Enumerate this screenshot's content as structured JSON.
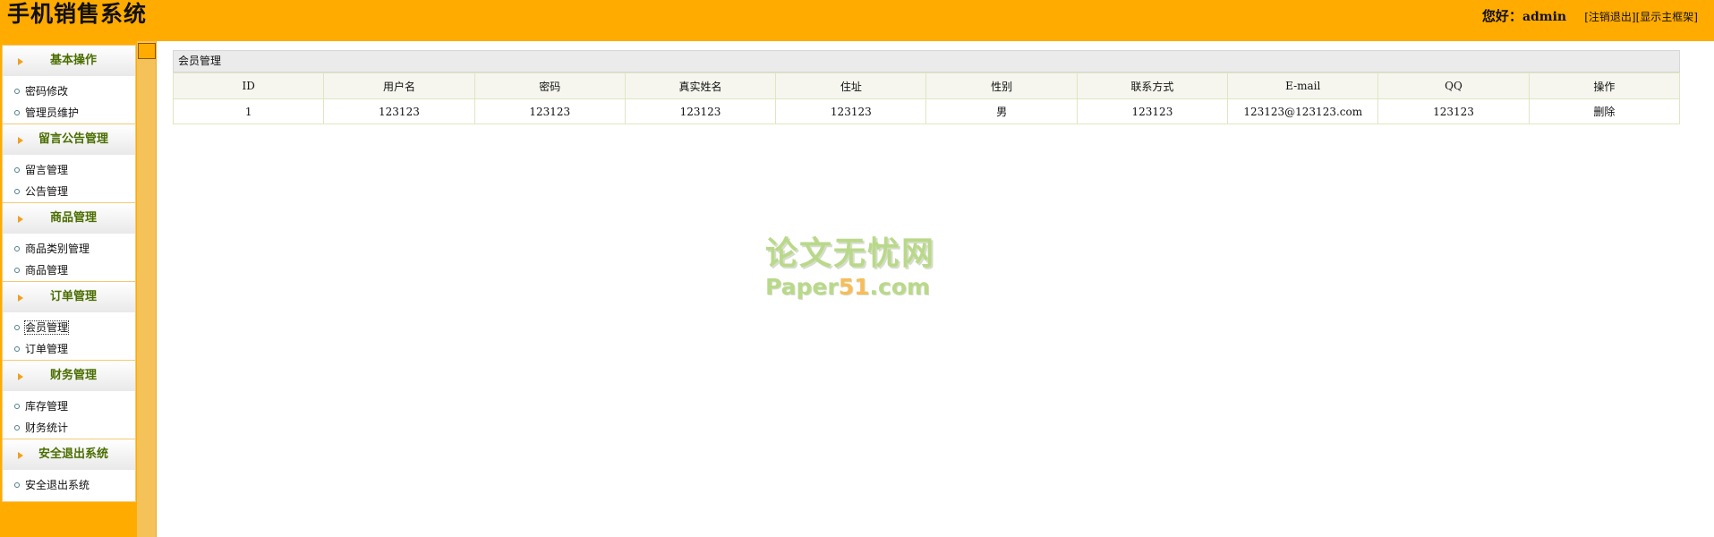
{
  "header": {
    "title": "手机销售系统",
    "greeting_prefix": "您好：",
    "user_name": "admin",
    "logout_link": "[注销退出]",
    "show_frame_link": "[显示主框架]"
  },
  "sidebar": {
    "groups": [
      {
        "title": "基本操作",
        "items": [
          "密码修改",
          "管理员维护"
        ]
      },
      {
        "title": "留言公告管理",
        "items": [
          "留言管理",
          "公告管理"
        ]
      },
      {
        "title": "商品管理",
        "items": [
          "商品类别管理",
          "商品管理"
        ]
      },
      {
        "title": "订单管理",
        "items": [
          "会员管理",
          "订单管理"
        ]
      },
      {
        "title": "财务管理",
        "items": [
          "库存管理",
          "财务统计"
        ]
      },
      {
        "title": "安全退出系统",
        "items": [
          "安全退出系统"
        ]
      }
    ]
  },
  "main": {
    "panel_title": "会员管理",
    "columns": [
      "ID",
      "用户名",
      "密码",
      "真实姓名",
      "住址",
      "性别",
      "联系方式",
      "E-mail",
      "QQ",
      "操作"
    ],
    "rows": [
      [
        "1",
        "123123",
        "123123",
        "123123",
        "123123",
        "男",
        "123123",
        "123123@123123.com",
        "123123",
        "删除"
      ]
    ]
  },
  "watermark": {
    "cn_text": "论文无忧网",
    "en_prefix": "Paper",
    "en_highlight": "51",
    "en_suffix": ".com"
  },
  "colors": {
    "header_bg": "#ffab00",
    "menu_title_text": "#4a6e00",
    "table_border": "#dfe6c3",
    "table_header_bg": "#f6f6ef"
  }
}
